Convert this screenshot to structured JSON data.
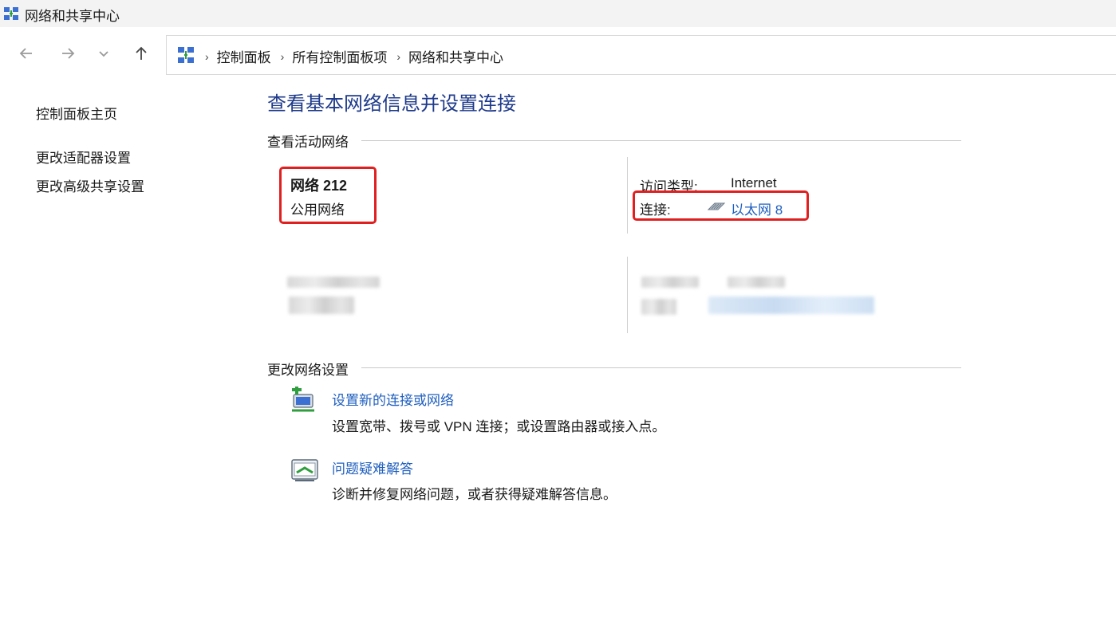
{
  "window": {
    "title": "网络和共享中心"
  },
  "breadcrumb": [
    "控制面板",
    "所有控制面板项",
    "网络和共享中心"
  ],
  "sidebar": {
    "home": "控制面板主页",
    "items": [
      "更改适配器设置",
      "更改高级共享设置"
    ]
  },
  "main": {
    "title": "查看基本网络信息并设置连接",
    "active_networks_header": "查看活动网络",
    "network1": {
      "name": "网络 212",
      "category": "公用网络",
      "access_type_label": "访问类型:",
      "access_type_value": "Internet",
      "connection_label": "连接:",
      "connection_value": "以太网 8"
    },
    "change_settings_header": "更改网络设置",
    "tasks": [
      {
        "link": "设置新的连接或网络",
        "desc": "设置宽带、拨号或 VPN 连接；或设置路由器或接入点。",
        "icon": "new-connection-icon"
      },
      {
        "link": "问题疑难解答",
        "desc": "诊断并修复网络问题，或者获得疑难解答信息。",
        "icon": "troubleshoot-icon"
      }
    ]
  },
  "colors": {
    "accent_title": "#1e3a8a",
    "link": "#1f5fbf",
    "highlight_box": "#e02020"
  }
}
